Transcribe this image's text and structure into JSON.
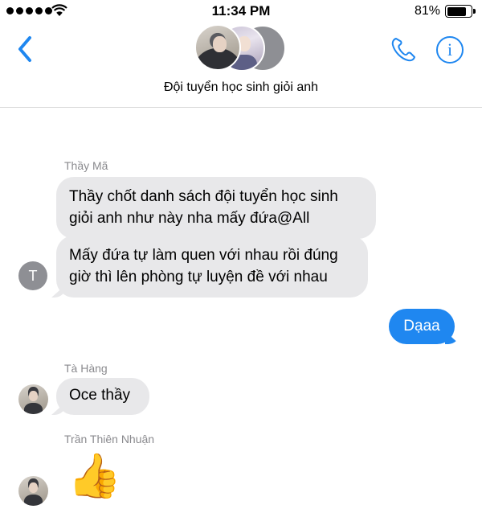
{
  "status_bar": {
    "time": "11:34 PM",
    "battery_percent": "81%",
    "battery_level": 0.81,
    "signal_bars": 5,
    "wifi_icon": "wifi-icon"
  },
  "header": {
    "group_name": "Đội tuyển học sinh giỏi anh",
    "back_icon": "chevron-left-icon",
    "call_icon": "phone-icon",
    "info_icon": "info-icon",
    "info_glyph": "i"
  },
  "messages": [
    {
      "sender": "Thầy Mã",
      "avatar_initial": "T",
      "text": "Thầy chốt danh sách đội tuyển học sinh giỏi anh như này nha mấy đứa@All"
    },
    {
      "text": "Mấy đứa tự làm quen với nhau rồi đúng giờ thì lên phòng tự luyện đề với nhau"
    },
    {
      "outgoing": true,
      "text": "Dạaa"
    },
    {
      "sender": "Tà Hàng",
      "text": "Oce thầy"
    },
    {
      "sender": "Trần Thiên Nhuận",
      "emoji": "👍"
    }
  ],
  "colors": {
    "accent": "#1f87f0",
    "incoming_bubble": "#e8e8ea",
    "sender_label": "#8a8a8e",
    "avatar_gray": "#8e8f94"
  }
}
